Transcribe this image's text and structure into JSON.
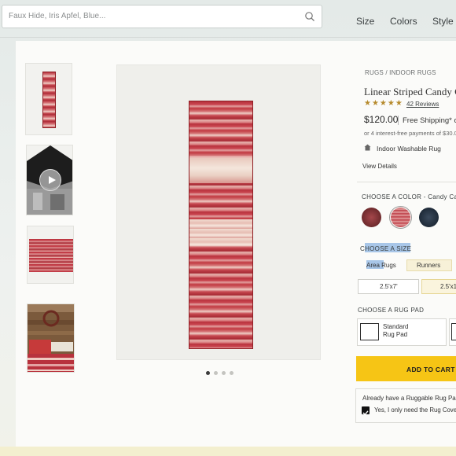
{
  "search": {
    "placeholder": "Faux Hide, Iris Apfel, Blue..."
  },
  "nav": {
    "size": "Size",
    "colors": "Colors",
    "style": "Style"
  },
  "product": {
    "breadcrumb": "RUGS / INDOOR RUGS",
    "title": "Linear Striped Candy C",
    "rating_stars": "★★★★★",
    "rating_value": 4.5,
    "reviews": "42 Reviews",
    "price": "$120.00",
    "shipping": "Free Shipping* o",
    "installments": "or 4 interest-free payments of $30.0",
    "feature": "Indoor Washable Rug",
    "view_details": "View Details"
  },
  "color": {
    "label": "CHOOSE A COLOR - Candy Cane",
    "swatches": [
      {
        "name": "burgundy",
        "color": "#6e2a2d"
      },
      {
        "name": "candy-cane",
        "color": "#c4474f",
        "selected": true
      },
      {
        "name": "navy",
        "color": "#1e2a38"
      }
    ]
  },
  "size": {
    "label_prefix": "C",
    "label_highlight": "HOOSE A SIZE",
    "tabs": {
      "area_hl": "Area",
      "area_rest": " Rugs",
      "runners": "Runners"
    },
    "options": [
      {
        "label": "2.5'x7'",
        "selected": false
      },
      {
        "label": "2.5'x1",
        "selected": true
      }
    ]
  },
  "pad": {
    "label": "CHOOSE A RUG PAD",
    "option1_line1": "Standard",
    "option1_line2": "Rug Pad"
  },
  "cart": {
    "label": "ADD TO CART"
  },
  "pad_box": {
    "question": "Already have a Ruggable Rug Pa",
    "yes": "Yes, I only need the Rug Cove"
  },
  "gallery": {
    "total": 4,
    "active_index": 0
  },
  "colors": {
    "accent_yellow": "#f6c515",
    "star": "#b68a2c",
    "rug_red": "#c4474f"
  },
  "icons": {
    "search": "search-icon",
    "play": "play-icon",
    "washable": "washable-icon",
    "check": "checkbox-checked-icon"
  }
}
